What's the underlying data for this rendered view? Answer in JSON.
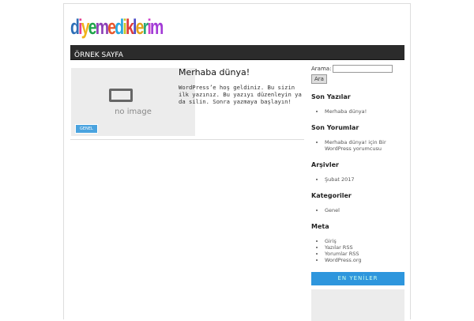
{
  "site": {
    "logo": "diyemediklerim",
    "logo_colors": [
      "#2e6fb7",
      "#e63d8f",
      "#f1b21a",
      "#1fa34a",
      "#8d3fb6",
      "#e8572a",
      "#27a7df",
      "#c6c82a",
      "#de3a3a",
      "#4c4cc8",
      "#e3a21c",
      "#2aa876",
      "#cf42cc",
      "#a23ad6"
    ]
  },
  "nav": {
    "items": [
      "ÖRNEK SAYFA"
    ]
  },
  "post": {
    "title": "Merhaba dünya!",
    "excerpt": "WordPress’e hoş geldiniz. Bu sizin ilk yazınız. Bu yazıyı düzenleyin ya da silin. Sonra yazmaya başlayın!",
    "thumb_text": "no image",
    "category": "GENEL"
  },
  "sidebar": {
    "search_label": "Arama:",
    "search_value": "",
    "search_button": "Ara",
    "widgets": [
      {
        "title": "Son Yazılar",
        "items": [
          "Merhaba dünya!"
        ]
      },
      {
        "title": "Son Yorumlar",
        "items": [
          "Merhaba dünya! için Bir WordPress yorumcusu"
        ]
      },
      {
        "title": "Arşivler",
        "items": [
          "Şubat 2017"
        ]
      },
      {
        "title": "Kategoriler",
        "items": [
          "Genel"
        ]
      },
      {
        "title": "Meta",
        "items": [
          "Giriş",
          "Yazılar RSS",
          "Yorumlar RSS",
          "WordPress.org"
        ]
      }
    ],
    "latest_label": "EN YENİLER"
  }
}
